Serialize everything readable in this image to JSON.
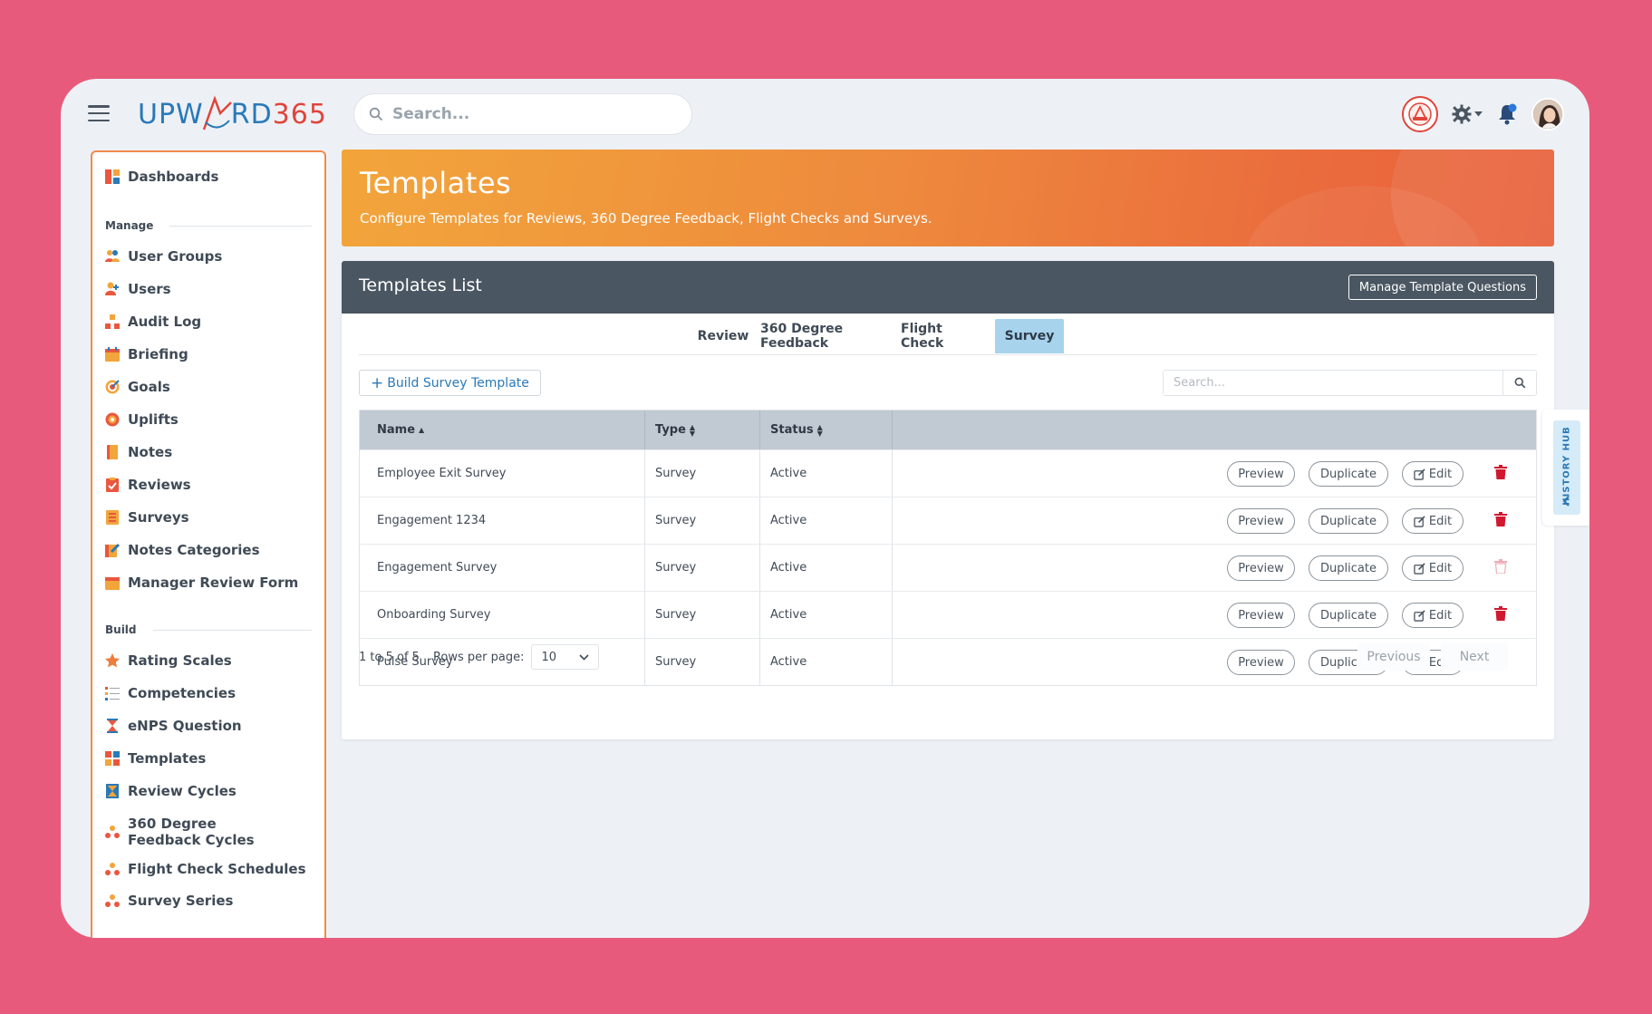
{
  "app": {
    "logo_left": "UPW",
    "logo_mid": "RD",
    "logo_right": "365"
  },
  "header": {
    "search_placeholder": "Search..."
  },
  "sidebar": {
    "dashboards": "Dashboards",
    "manage_label": "Manage",
    "manage_items": [
      "User Groups",
      "Users",
      "Audit Log",
      "Briefing",
      "Goals",
      "Uplifts",
      "Notes",
      "Reviews",
      "Surveys",
      "Notes Categories",
      "Manager Review Form"
    ],
    "build_label": "Build",
    "build_items": [
      "Rating Scales",
      "Competencies",
      "eNPS Question",
      "Templates",
      "Review Cycles",
      "360 Degree Feedback Cycles",
      "Flight Check Schedules",
      "Survey Series"
    ]
  },
  "banner": {
    "title": "Templates",
    "subtitle": "Configure Templates for Reviews, 360 Degree Feedback, Flight Checks and Surveys."
  },
  "card": {
    "title": "Templates List",
    "manage_button": "Manage Template Questions",
    "tabs": [
      "Review",
      "360 Degree Feedback",
      "Flight Check",
      "Survey"
    ],
    "active_tab": "Survey",
    "build_button": "Build Survey Template",
    "search_placeholder": "Search...",
    "columns": [
      "Name",
      "Type",
      "Status"
    ],
    "rows": [
      {
        "name": "Employee Exit Survey",
        "type": "Survey",
        "status": "Active"
      },
      {
        "name": "Engagement 1234",
        "type": "Survey",
        "status": "Active"
      },
      {
        "name": "Engagement Survey",
        "type": "Survey",
        "status": "Active"
      },
      {
        "name": "Onboarding Survey",
        "type": "Survey",
        "status": "Active"
      },
      {
        "name": "Pulse Survey",
        "type": "Survey",
        "status": "Active"
      }
    ],
    "actions": {
      "preview": "Preview",
      "duplicate": "Duplicate",
      "edit": "Edit"
    },
    "pagination": {
      "summary": "1 to 5 of 5",
      "rows_label": "Rows per page:",
      "rows_value": "10",
      "previous": "Previous",
      "next": "Next"
    }
  },
  "history_hub": {
    "label": "HISTORY HUB"
  },
  "colors": {
    "accent": "#2a79b8",
    "banner_start": "#f2a53b",
    "banner_end": "#e8603b",
    "danger": "#d0182f",
    "header_dark": "#4a5661"
  }
}
